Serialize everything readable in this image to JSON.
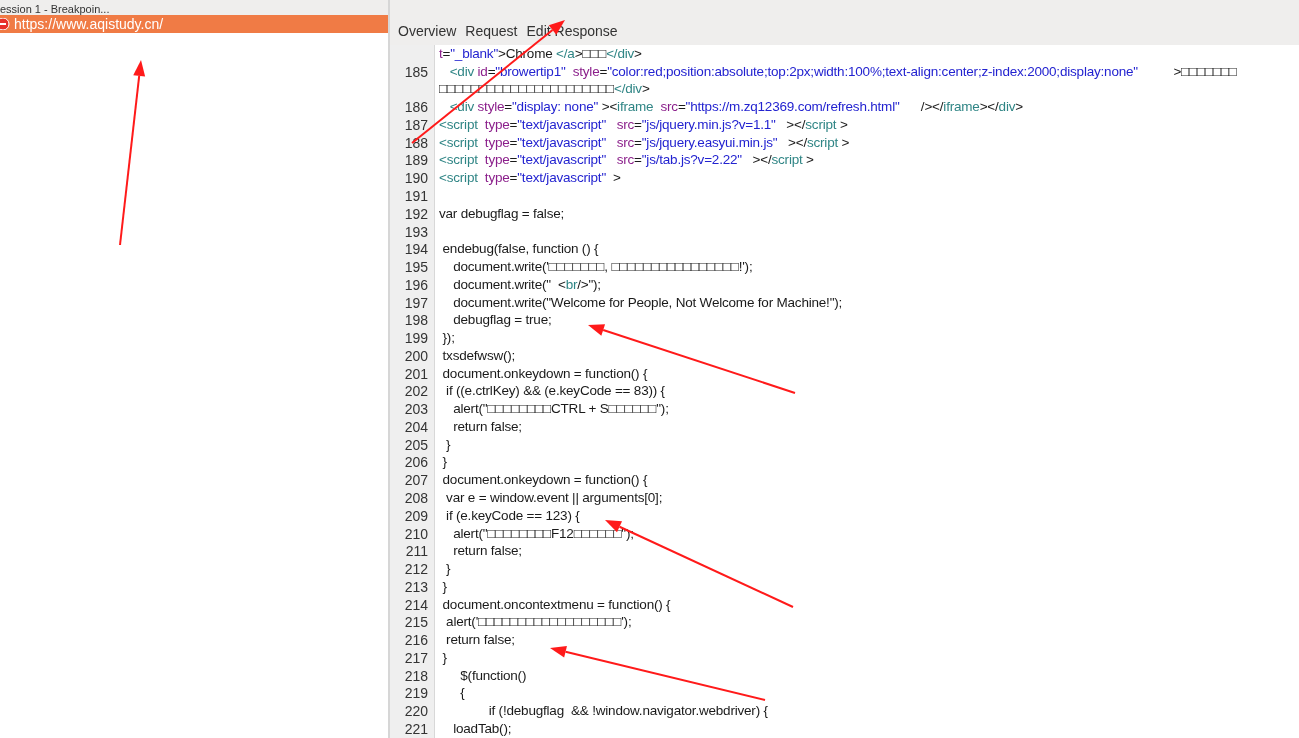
{
  "session_title": "ession 1 - Breakpoin...",
  "sessions": [
    {
      "label": "https://www.aqistudy.cn/",
      "selected": true
    }
  ],
  "tabs": [
    {
      "label": "Overview"
    },
    {
      "label": "Request"
    },
    {
      "label": "Edit Response"
    }
  ],
  "code_lines": [
    {
      "segments": [
        {
          "kind": "attr",
          "text": "t"
        },
        {
          "kind": "text",
          "text": "="
        },
        {
          "kind": "value",
          "text": "\"_blank\""
        },
        {
          "kind": "text",
          "text": ">Chrome "
        },
        {
          "kind": "tag",
          "text": "</a"
        },
        {
          "kind": "text",
          "text": ">□□□"
        },
        {
          "kind": "tag",
          "text": "</div"
        },
        {
          "kind": "text",
          "text": ">"
        }
      ]
    },
    {
      "number": "185",
      "segments": [
        {
          "kind": "tag",
          "text": "   <div"
        },
        {
          "kind": "attr",
          "text": " id"
        },
        {
          "kind": "text",
          "text": "="
        },
        {
          "kind": "value",
          "text": "\"browertip1\""
        },
        {
          "kind": "attr",
          "text": "  style"
        },
        {
          "kind": "text",
          "text": "="
        },
        {
          "kind": "value",
          "text": "\"color:red;position:absolute;top:2px;width:100%;text-align:center;z-index:2000;display:none\""
        },
        {
          "kind": "text",
          "text": "          >□□□□□□□"
        }
      ]
    },
    {
      "segments": [
        {
          "kind": "text",
          "text": "□□□□□□□□□□□□□□□□□□□□□□"
        },
        {
          "kind": "tag",
          "text": "</div"
        },
        {
          "kind": "text",
          "text": ">"
        }
      ]
    },
    {
      "number": "186",
      "segments": [
        {
          "kind": "tag",
          "text": "   <div"
        },
        {
          "kind": "attr",
          "text": " style"
        },
        {
          "kind": "text",
          "text": "="
        },
        {
          "kind": "value",
          "text": "\"display: none\""
        },
        {
          "kind": "text",
          "text": " ><"
        },
        {
          "kind": "tag",
          "text": "iframe"
        },
        {
          "kind": "attr",
          "text": "  src"
        },
        {
          "kind": "text",
          "text": "="
        },
        {
          "kind": "value",
          "text": "\"https://m.zq12369.com/refresh.html\""
        },
        {
          "kind": "text",
          "text": "      /></"
        },
        {
          "kind": "tag",
          "text": "iframe"
        },
        {
          "kind": "text",
          "text": "></"
        },
        {
          "kind": "tag",
          "text": "div"
        },
        {
          "kind": "text",
          "text": ">"
        }
      ]
    },
    {
      "number": "187",
      "segments": [
        {
          "kind": "tag",
          "text": "<script"
        },
        {
          "kind": "attr",
          "text": "  type"
        },
        {
          "kind": "text",
          "text": "="
        },
        {
          "kind": "value",
          "text": "\"text/javascript\""
        },
        {
          "kind": "attr",
          "text": "   src"
        },
        {
          "kind": "text",
          "text": "="
        },
        {
          "kind": "value",
          "text": "\"js/jquery.min.js?v=1.1\""
        },
        {
          "kind": "text",
          "text": "   ></"
        },
        {
          "kind": "tag",
          "text": "script"
        },
        {
          "kind": "text",
          "text": " >"
        }
      ]
    },
    {
      "number": "188",
      "segments": [
        {
          "kind": "tag",
          "text": "<script"
        },
        {
          "kind": "attr",
          "text": "  type"
        },
        {
          "kind": "text",
          "text": "="
        },
        {
          "kind": "value",
          "text": "\"text/javascript\""
        },
        {
          "kind": "attr",
          "text": "   src"
        },
        {
          "kind": "text",
          "text": "="
        },
        {
          "kind": "value",
          "text": "\"js/jquery.easyui.min.js\""
        },
        {
          "kind": "text",
          "text": "   ></"
        },
        {
          "kind": "tag",
          "text": "script"
        },
        {
          "kind": "text",
          "text": " >"
        }
      ]
    },
    {
      "number": "189",
      "segments": [
        {
          "kind": "tag",
          "text": "<script"
        },
        {
          "kind": "attr",
          "text": "  type"
        },
        {
          "kind": "text",
          "text": "="
        },
        {
          "kind": "value",
          "text": "\"text/javascript\""
        },
        {
          "kind": "attr",
          "text": "   src"
        },
        {
          "kind": "text",
          "text": "="
        },
        {
          "kind": "value",
          "text": "\"js/tab.js?v=2.22\""
        },
        {
          "kind": "text",
          "text": "   ></"
        },
        {
          "kind": "tag",
          "text": "script"
        },
        {
          "kind": "text",
          "text": " >"
        }
      ]
    },
    {
      "number": "190",
      "segments": [
        {
          "kind": "tag",
          "text": "<script"
        },
        {
          "kind": "attr",
          "text": "  type"
        },
        {
          "kind": "text",
          "text": "="
        },
        {
          "kind": "value",
          "text": "\"text/javascript\""
        },
        {
          "kind": "text",
          "text": "  >"
        }
      ]
    },
    {
      "number": "191"
    },
    {
      "number": "192",
      "segments": [
        {
          "kind": "text",
          "text": "var debugflag = false;"
        }
      ]
    },
    {
      "number": "193"
    },
    {
      "number": "194",
      "segments": [
        {
          "kind": "text",
          "text": " endebug(false, function () {"
        }
      ]
    },
    {
      "number": "195",
      "segments": [
        {
          "kind": "text",
          "text": "    document.write('□□□□□□□, □□□□□□□□□□□□□□□□!');"
        }
      ]
    },
    {
      "number": "196",
      "segments": [
        {
          "kind": "text",
          "text": "    document.write(\"  <"
        },
        {
          "kind": "tag",
          "text": "br"
        },
        {
          "kind": "text",
          "text": "/>\");"
        }
      ]
    },
    {
      "number": "197",
      "segments": [
        {
          "kind": "text",
          "text": "    document.write(\"Welcome for People, Not Welcome for Machine!\");"
        }
      ]
    },
    {
      "number": "198",
      "segments": [
        {
          "kind": "text",
          "text": "    debugflag = true;"
        }
      ]
    },
    {
      "number": "199",
      "segments": [
        {
          "kind": "text",
          "text": " });"
        }
      ]
    },
    {
      "number": "200",
      "segments": [
        {
          "kind": "text",
          "text": " txsdefwsw();"
        }
      ]
    },
    {
      "number": "201",
      "segments": [
        {
          "kind": "text",
          "text": " document.onkeydown = function() {"
        }
      ]
    },
    {
      "number": "202",
      "segments": [
        {
          "kind": "text",
          "text": "  if ((e.ctrlKey) && (e.keyCode == 83)) {"
        }
      ]
    },
    {
      "number": "203",
      "segments": [
        {
          "kind": "text",
          "text": "    alert(\"□□□□□□□□CTRL + S□□□□□□\");"
        }
      ]
    },
    {
      "number": "204",
      "segments": [
        {
          "kind": "text",
          "text": "    return false;"
        }
      ]
    },
    {
      "number": "205",
      "segments": [
        {
          "kind": "text",
          "text": "  }"
        }
      ]
    },
    {
      "number": "206",
      "segments": [
        {
          "kind": "text",
          "text": " }"
        }
      ]
    },
    {
      "number": "207",
      "segments": [
        {
          "kind": "text",
          "text": " document.onkeydown = function() {"
        }
      ]
    },
    {
      "number": "208",
      "segments": [
        {
          "kind": "text",
          "text": "  var e = window.event || arguments[0];"
        }
      ]
    },
    {
      "number": "209",
      "segments": [
        {
          "kind": "text",
          "text": "  if (e.keyCode == 123) {"
        }
      ]
    },
    {
      "number": "210",
      "segments": [
        {
          "kind": "text",
          "text": "    alert(\"□□□□□□□□F12□□□□□□\");"
        }
      ]
    },
    {
      "number": "211",
      "segments": [
        {
          "kind": "text",
          "text": "    return false;"
        }
      ]
    },
    {
      "number": "212",
      "segments": [
        {
          "kind": "text",
          "text": "  }"
        }
      ]
    },
    {
      "number": "213",
      "segments": [
        {
          "kind": "text",
          "text": " }"
        }
      ]
    },
    {
      "number": "214",
      "segments": [
        {
          "kind": "text",
          "text": " document.oncontextmenu = function() {"
        }
      ]
    },
    {
      "number": "215",
      "segments": [
        {
          "kind": "text",
          "text": "  alert('□□□□□□□□□□□□□□□□□□');"
        }
      ]
    },
    {
      "number": "216",
      "segments": [
        {
          "kind": "text",
          "text": "  return false;"
        }
      ]
    },
    {
      "number": "217",
      "segments": [
        {
          "kind": "text",
          "text": " }"
        }
      ]
    },
    {
      "number": "218",
      "segments": [
        {
          "kind": "text",
          "text": "      $(function()"
        }
      ]
    },
    {
      "number": "219",
      "segments": [
        {
          "kind": "text",
          "text": "      {"
        }
      ]
    },
    {
      "number": "220",
      "segments": [
        {
          "kind": "text",
          "text": "              if (!debugflag  && !window.navigator.webdriver) {"
        }
      ]
    },
    {
      "number": "221",
      "segments": [
        {
          "kind": "text",
          "text": "    loadTab();"
        }
      ]
    }
  ]
}
